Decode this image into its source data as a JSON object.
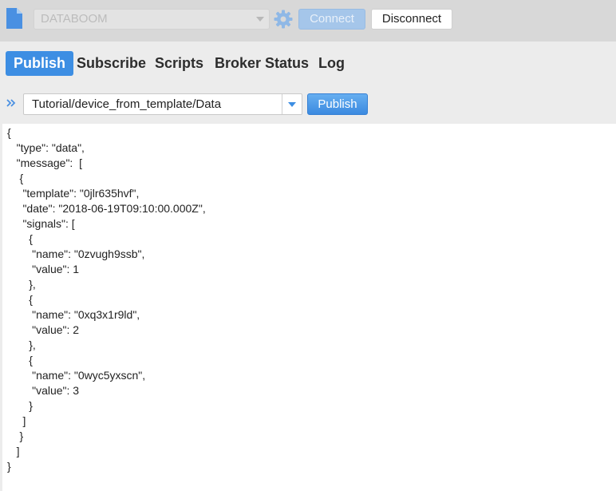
{
  "topbar": {
    "profile_selected": "DATABOOM",
    "connect_label": "Connect",
    "disconnect_label": "Disconnect"
  },
  "tabs": [
    {
      "label": "Publish",
      "active": true
    },
    {
      "label": "Subscribe",
      "active": false
    },
    {
      "label": "Scripts",
      "active": false
    },
    {
      "label": "Broker Status",
      "active": false
    },
    {
      "label": "Log",
      "active": false
    }
  ],
  "publish": {
    "topic": "Tutorial/device_from_template/Data",
    "button_label": "Publish",
    "payload": "{\n   \"type\": \"data\",\n   \"message\":  [\n    {\n     \"template\": \"0jlr635hvf\",\n     \"date\": \"2018-06-19T09:10:00.000Z\",\n     \"signals\": [\n       {\n        \"name\": \"0zvugh9ssb\",\n        \"value\": 1\n       },\n       {\n        \"name\": \"0xq3x1r9ld\",\n        \"value\": 2\n       },\n       {\n        \"name\": \"0wyc5yxscn\",\n        \"value\": 3\n       }\n     ]\n    }\n   ]\n}"
  },
  "colors": {
    "accent": "#3d8ee3",
    "connect_disabled": "#a5c6ea",
    "topbar_bg": "#d8d8d8"
  },
  "icons": [
    "document-icon",
    "gear-icon",
    "chevron-down-icon",
    "double-chevron-right-icon"
  ]
}
